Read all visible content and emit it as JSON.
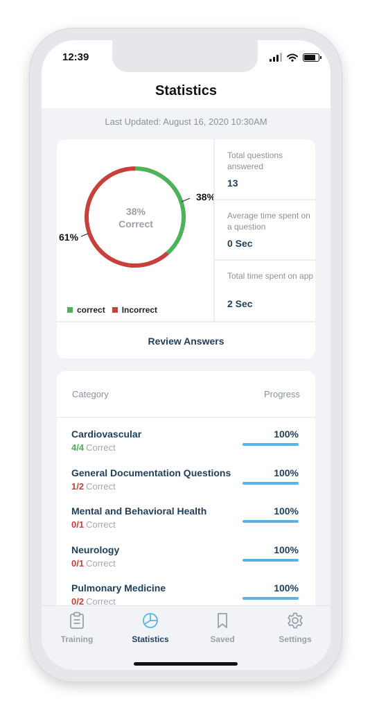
{
  "status_bar": {
    "time": "12:39"
  },
  "header": {
    "title": "Statistics"
  },
  "last_updated": "Last Updated: August 16, 2020 10:30AM",
  "summary": {
    "center_percent": "38%",
    "center_label": "Correct",
    "label_correct_pct": "38%",
    "label_incorrect_pct": "61%",
    "legend": [
      {
        "label": "correct",
        "color": "#4cb35a"
      },
      {
        "label": "Incorrect",
        "color": "#c8403a"
      }
    ],
    "stats": [
      {
        "label": "Total questions answered",
        "value": "13"
      },
      {
        "label": "Average time spent on a question",
        "value": "0 Sec"
      },
      {
        "label": "Total time spent on app",
        "value": "2 Sec"
      }
    ],
    "review_label": "Review Answers"
  },
  "chart_data": {
    "type": "pie",
    "categories": [
      "correct",
      "Incorrect"
    ],
    "values": [
      38,
      61
    ],
    "title": "",
    "legend_position": "bottom-left"
  },
  "categories_table": {
    "header_category": "Category",
    "header_progress": "Progress",
    "correct_word": "Correct",
    "rows": [
      {
        "name": "Cardiovascular",
        "progress_label": "100%",
        "progress": 1.0,
        "fraction": "4/4",
        "fraction_color": "#4cb35a"
      },
      {
        "name": "General Documentation Questions",
        "progress_label": "100%",
        "progress": 1.0,
        "fraction": "1/2",
        "fraction_color": "#c8403a"
      },
      {
        "name": "Mental and Behavioral Health",
        "progress_label": "100%",
        "progress": 1.0,
        "fraction": "0/1",
        "fraction_color": "#c8403a"
      },
      {
        "name": "Neurology",
        "progress_label": "100%",
        "progress": 1.0,
        "fraction": "0/1",
        "fraction_color": "#c8403a"
      },
      {
        "name": "Pulmonary Medicine",
        "progress_label": "100%",
        "progress": 1.0,
        "fraction": "0/2",
        "fraction_color": "#c8403a"
      }
    ]
  },
  "tabs": [
    {
      "label": "Training",
      "icon": "clipboard-icon",
      "active": false
    },
    {
      "label": "Statistics",
      "icon": "pie-chart-icon",
      "active": true
    },
    {
      "label": "Saved",
      "icon": "bookmark-icon",
      "active": false
    },
    {
      "label": "Settings",
      "icon": "gear-icon",
      "active": false
    }
  ],
  "colors": {
    "accent": "#1f3d5c",
    "correct": "#4cb35a",
    "incorrect": "#c8403a",
    "progress": "#5ab3e6"
  }
}
